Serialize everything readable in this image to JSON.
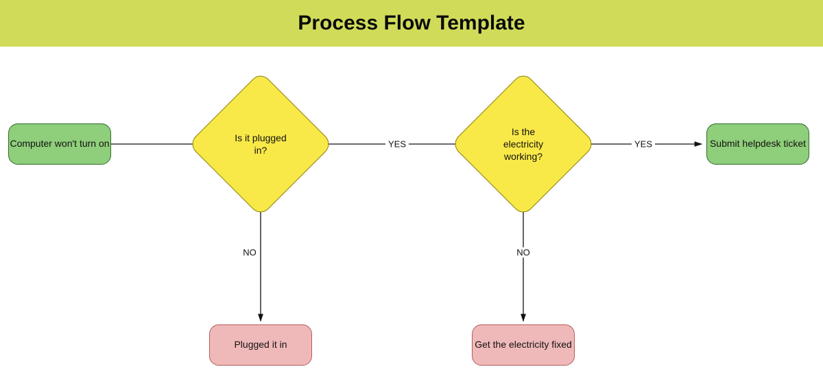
{
  "header": {
    "title": "Process Flow Template"
  },
  "colors": {
    "header_bg": "#d0dc59",
    "terminal_fill": "#8fce7a",
    "terminal_stroke": "#2d6a2a",
    "decision_fill": "#f9e948",
    "decision_stroke": "#8b7d06",
    "action_fill": "#f0b9b9",
    "action_stroke": "#b35a5a"
  },
  "nodes": {
    "start": {
      "type": "terminal",
      "label": "Computer won't turn on"
    },
    "decision1": {
      "type": "decision",
      "label": "Is it plugged in?"
    },
    "decision2": {
      "type": "decision",
      "label": "Is the electricity working?"
    },
    "end": {
      "type": "terminal",
      "label": "Submit helpdesk ticket"
    },
    "action1": {
      "type": "action",
      "label": "Plugged it in"
    },
    "action2": {
      "type": "action",
      "label": "Get the electricity fixed"
    }
  },
  "edges": [
    {
      "from": "start",
      "to": "decision1",
      "label": ""
    },
    {
      "from": "decision1",
      "to": "decision2",
      "label": "YES"
    },
    {
      "from": "decision2",
      "to": "end",
      "label": "YES"
    },
    {
      "from": "decision1",
      "to": "action1",
      "label": "NO"
    },
    {
      "from": "decision2",
      "to": "action2",
      "label": "NO"
    }
  ]
}
